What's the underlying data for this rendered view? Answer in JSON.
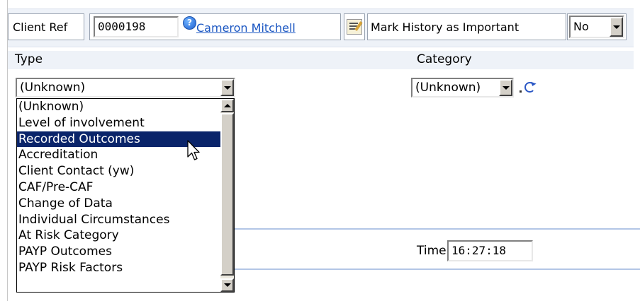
{
  "toolbar": {
    "client_ref_label": "Client Ref",
    "client_ref_value": "0000198",
    "client_name_link": "Cameron Mitchell",
    "mark_history_label": "Mark History as Important",
    "mark_history_value": "No",
    "icons": [
      "info-icon",
      "edit-notes-icon",
      "chevron-down-icon"
    ]
  },
  "form": {
    "type_label": "Type",
    "type_value": "(Unknown)",
    "category_label": "Category",
    "category_value": "(Unknown)",
    "time_label": "Time",
    "time_value": "16:27:18"
  },
  "type_dropdown": {
    "options": [
      "(Unknown)",
      "Level of involvement",
      "Recorded Outcomes",
      "Accreditation",
      "Client Contact (yw)",
      "CAF/Pre-CAF",
      "Change of Data",
      "Individual Circumstances",
      "At Risk Category",
      "PAYP Outcomes",
      "PAYP Risk Factors"
    ],
    "highlighted": "Recorded Outcomes"
  },
  "colors": {
    "toolbar_bg": "#eef2f8",
    "link": "#1a56c2",
    "selection": "#0a246a",
    "section_line": "#b3c6e6"
  }
}
